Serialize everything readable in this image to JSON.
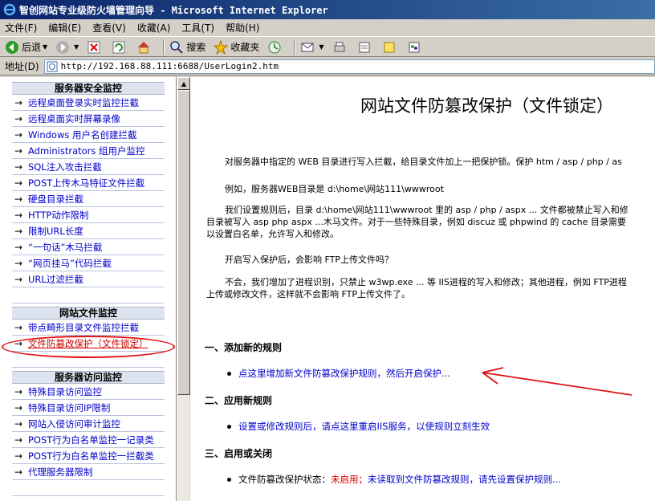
{
  "window": {
    "title": "智创网站专业级防火墙管理向导 - Microsoft Internet Explorer"
  },
  "menu": [
    "文件(F)",
    "编辑(E)",
    "查看(V)",
    "收藏(A)",
    "工具(T)",
    "帮助(H)"
  ],
  "toolbar": {
    "back": "后退",
    "search": "搜索",
    "favorites": "收藏夹"
  },
  "address": {
    "label": "地址(D)",
    "url": "http://192.168.88.111:6688/UserLogin2.htm"
  },
  "sidebar": {
    "arrow": "→",
    "sections": [
      {
        "title": "服务器安全监控",
        "items": [
          "远程桌面登录实时监控拦截",
          "远程桌面实时屏幕录像",
          "Windows 用户名创建拦截",
          "Administrators 组用户监控",
          "SQL注入攻击拦截",
          "POST上传木马特征文件拦截",
          "硬盘目录拦截",
          "HTTP动作限制",
          "限制URL长度",
          "“一句话”木马拦截",
          "“网页挂马”代码拦截",
          "URL过滤拦截"
        ]
      },
      {
        "title": "网站文件监控",
        "items": [
          "带点畸形目录文件监控拦截",
          "文件防篡改保护（文件锁定）"
        ]
      },
      {
        "title": "服务器访问监控",
        "items": [
          "特殊目录访问监控",
          "特殊目录访问IP限制",
          "网站入侵访问审计监控",
          "POST行为白名单监控一记录类",
          "POST行为白名单监控一拦截类",
          "代理服务器限制"
        ]
      }
    ]
  },
  "content": {
    "title": "网站文件防篡改保护（文件锁定）",
    "p1": "对服务器中指定的 WEB 目录进行写入拦截，给目录文件加上一把保护锁。保护 htm / asp / php / as",
    "p2": "例如，服务器WEB目录是 d:\\home\\网站111\\wwwroot",
    "p3a": "我们设置规则后，目录 d:\\home\\网站111\\wwwroot 里的 asp / php / aspx ... 文件都被禁止写入和修",
    "p3b": "目录被写入 asp php aspx ...木马文件。对于一些特殊目录，例如 discuz 或 phpwind 的 cache 目录需要",
    "p3c": "以设置白名单，允许写入和修改。",
    "p4": "开启写入保护后，会影响 FTP上传文件吗？",
    "p5a": "不会，我们增加了进程识别，只禁止 w3wp.exe ... 等 IIS进程的写入和修改；其他进程，例如 FTP进程",
    "p5b": "上传或修改文件，这样就不会影响 FTP上传文件了。",
    "s1": "一、添加新的规则",
    "s1_link": "点这里增加新文件防篡改保护规则，然后开启保护...",
    "s2": "二、应用新规则",
    "s2_link": "设置或修改规则后，请点这里重启IIS服务，以使规则立刻生效",
    "s3": "三、启用或关闭",
    "s3_label": "文件防篡改保护状态：",
    "s3_status": "未启用；",
    "s3_link": "未读取到文件防篡改规则，请先设置保护规则..."
  }
}
